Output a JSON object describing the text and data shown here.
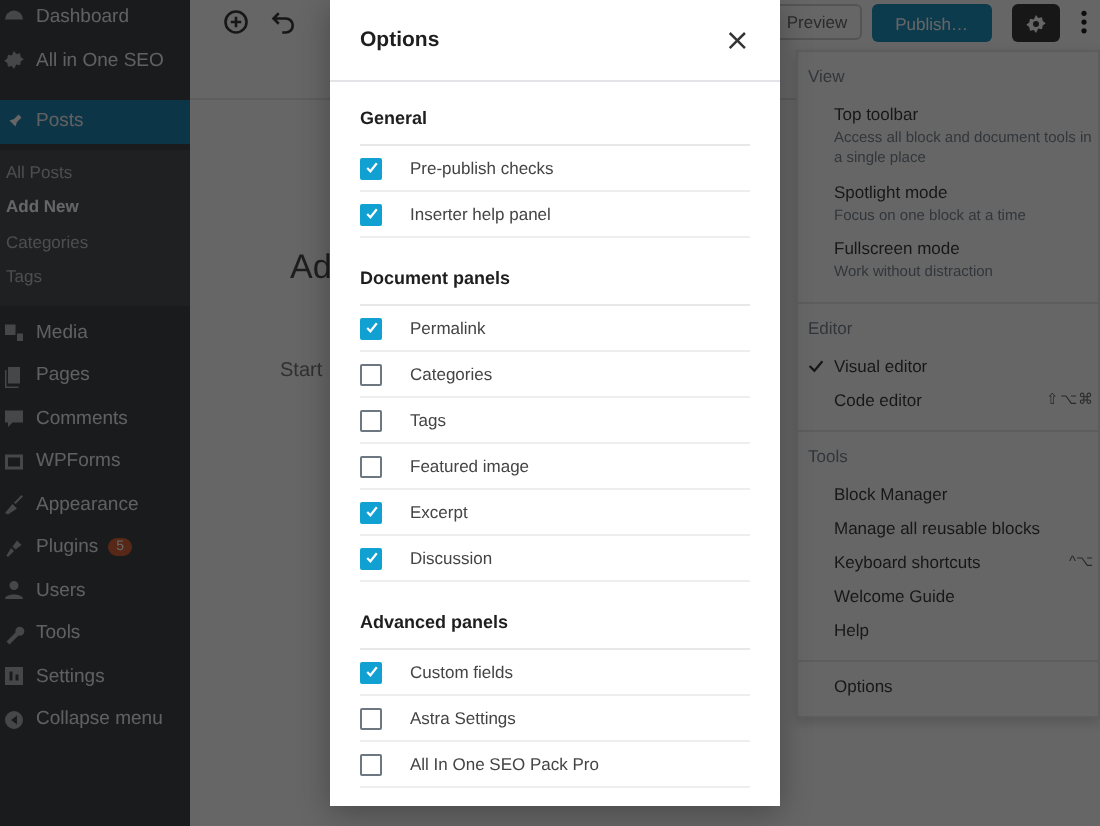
{
  "sidebar": {
    "items": [
      {
        "label": "Dashboard",
        "selected": false
      },
      {
        "label": "All in One SEO",
        "selected": false
      },
      {
        "label": "Posts",
        "selected": true
      },
      {
        "label": "Media",
        "selected": false
      },
      {
        "label": "Pages",
        "selected": false
      },
      {
        "label": "Comments",
        "selected": false
      },
      {
        "label": "WPForms",
        "selected": false
      },
      {
        "label": "Appearance",
        "selected": false
      },
      {
        "label": "Plugins",
        "selected": false,
        "badge": "5"
      },
      {
        "label": "Users",
        "selected": false
      },
      {
        "label": "Tools",
        "selected": false
      },
      {
        "label": "Settings",
        "selected": false
      },
      {
        "label": "Collapse menu",
        "selected": false
      }
    ],
    "submenu": [
      {
        "label": "All Posts",
        "selected": false
      },
      {
        "label": "Add New",
        "selected": true
      },
      {
        "label": "Categories",
        "selected": false
      },
      {
        "label": "Tags",
        "selected": false
      }
    ]
  },
  "toolbar": {
    "preview": "Preview",
    "publish": "Publish…"
  },
  "editor": {
    "title_fragment": "Ad",
    "body_fragment": "Start"
  },
  "modal": {
    "title": "Options",
    "close": "×",
    "sections": [
      {
        "title": "General",
        "options": [
          {
            "label": "Pre-publish checks",
            "checked": true
          },
          {
            "label": "Inserter help panel",
            "checked": true
          }
        ]
      },
      {
        "title": "Document panels",
        "options": [
          {
            "label": "Permalink",
            "checked": true
          },
          {
            "label": "Categories",
            "checked": false
          },
          {
            "label": "Tags",
            "checked": false
          },
          {
            "label": "Featured image",
            "checked": false
          },
          {
            "label": "Excerpt",
            "checked": true
          },
          {
            "label": "Discussion",
            "checked": true
          }
        ]
      },
      {
        "title": "Advanced panels",
        "options": [
          {
            "label": "Custom fields",
            "checked": true
          },
          {
            "label": "Astra Settings",
            "checked": false
          },
          {
            "label": "All In One SEO Pack Pro",
            "checked": false
          }
        ]
      }
    ]
  },
  "menu": {
    "groups": [
      {
        "title": "View",
        "items": [
          {
            "label": "Top toolbar",
            "description": "Access all block and document tools in a single place",
            "checked": false
          },
          {
            "label": "Spotlight mode",
            "description": "Focus on one block at a time",
            "checked": false
          },
          {
            "label": "Fullscreen mode",
            "description": "Work without distraction",
            "checked": false
          }
        ]
      },
      {
        "title": "Editor",
        "items": [
          {
            "label": "Visual editor",
            "checked": true
          },
          {
            "label": "Code editor",
            "shortcut": "⇧⌥⌘",
            "checked": false
          }
        ]
      },
      {
        "title": "Tools",
        "items": [
          {
            "label": "Block Manager",
            "checked": false
          },
          {
            "label": "Manage all reusable blocks",
            "checked": false
          },
          {
            "label": "Keyboard shortcuts",
            "shortcut": "^⌥",
            "checked": false
          },
          {
            "label": "Welcome Guide",
            "checked": false
          },
          {
            "label": "Help",
            "checked": false
          }
        ]
      },
      {
        "items": [
          {
            "label": "Options",
            "checked": false
          }
        ]
      }
    ]
  }
}
